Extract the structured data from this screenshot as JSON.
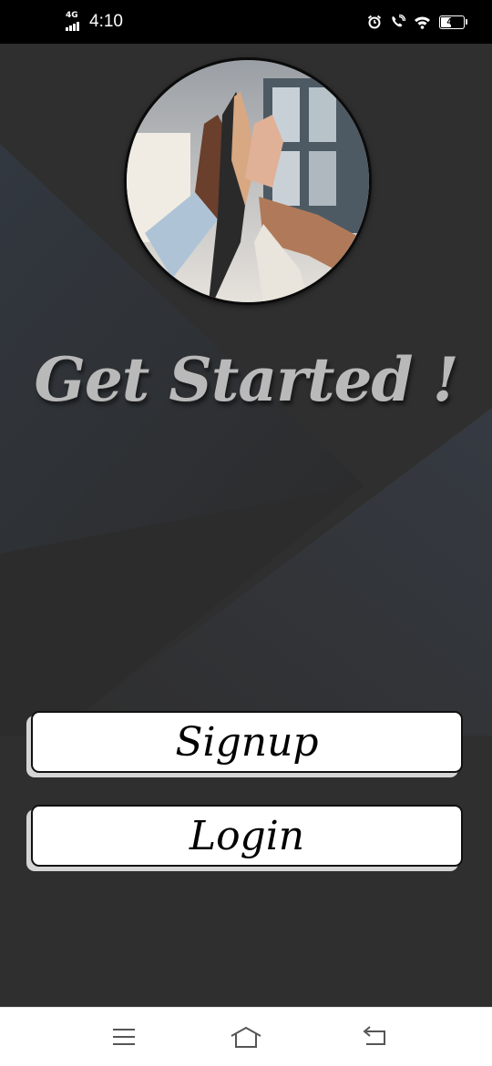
{
  "status_bar": {
    "network_label": "4G",
    "time": "4:10",
    "battery_level": "42",
    "icons": [
      "signal-icon",
      "alarm-icon",
      "wifi-call-icon",
      "wifi-icon",
      "battery-icon"
    ]
  },
  "main": {
    "background_color": "#2e2e2e",
    "avatar": {
      "description_icon": "team-high-five-image"
    },
    "title": "Get Started !",
    "buttons": {
      "signup_label": "Signup",
      "login_label": "Login"
    }
  },
  "nav_bar": {
    "icons": [
      "menu-icon",
      "home-icon",
      "back-icon"
    ]
  }
}
